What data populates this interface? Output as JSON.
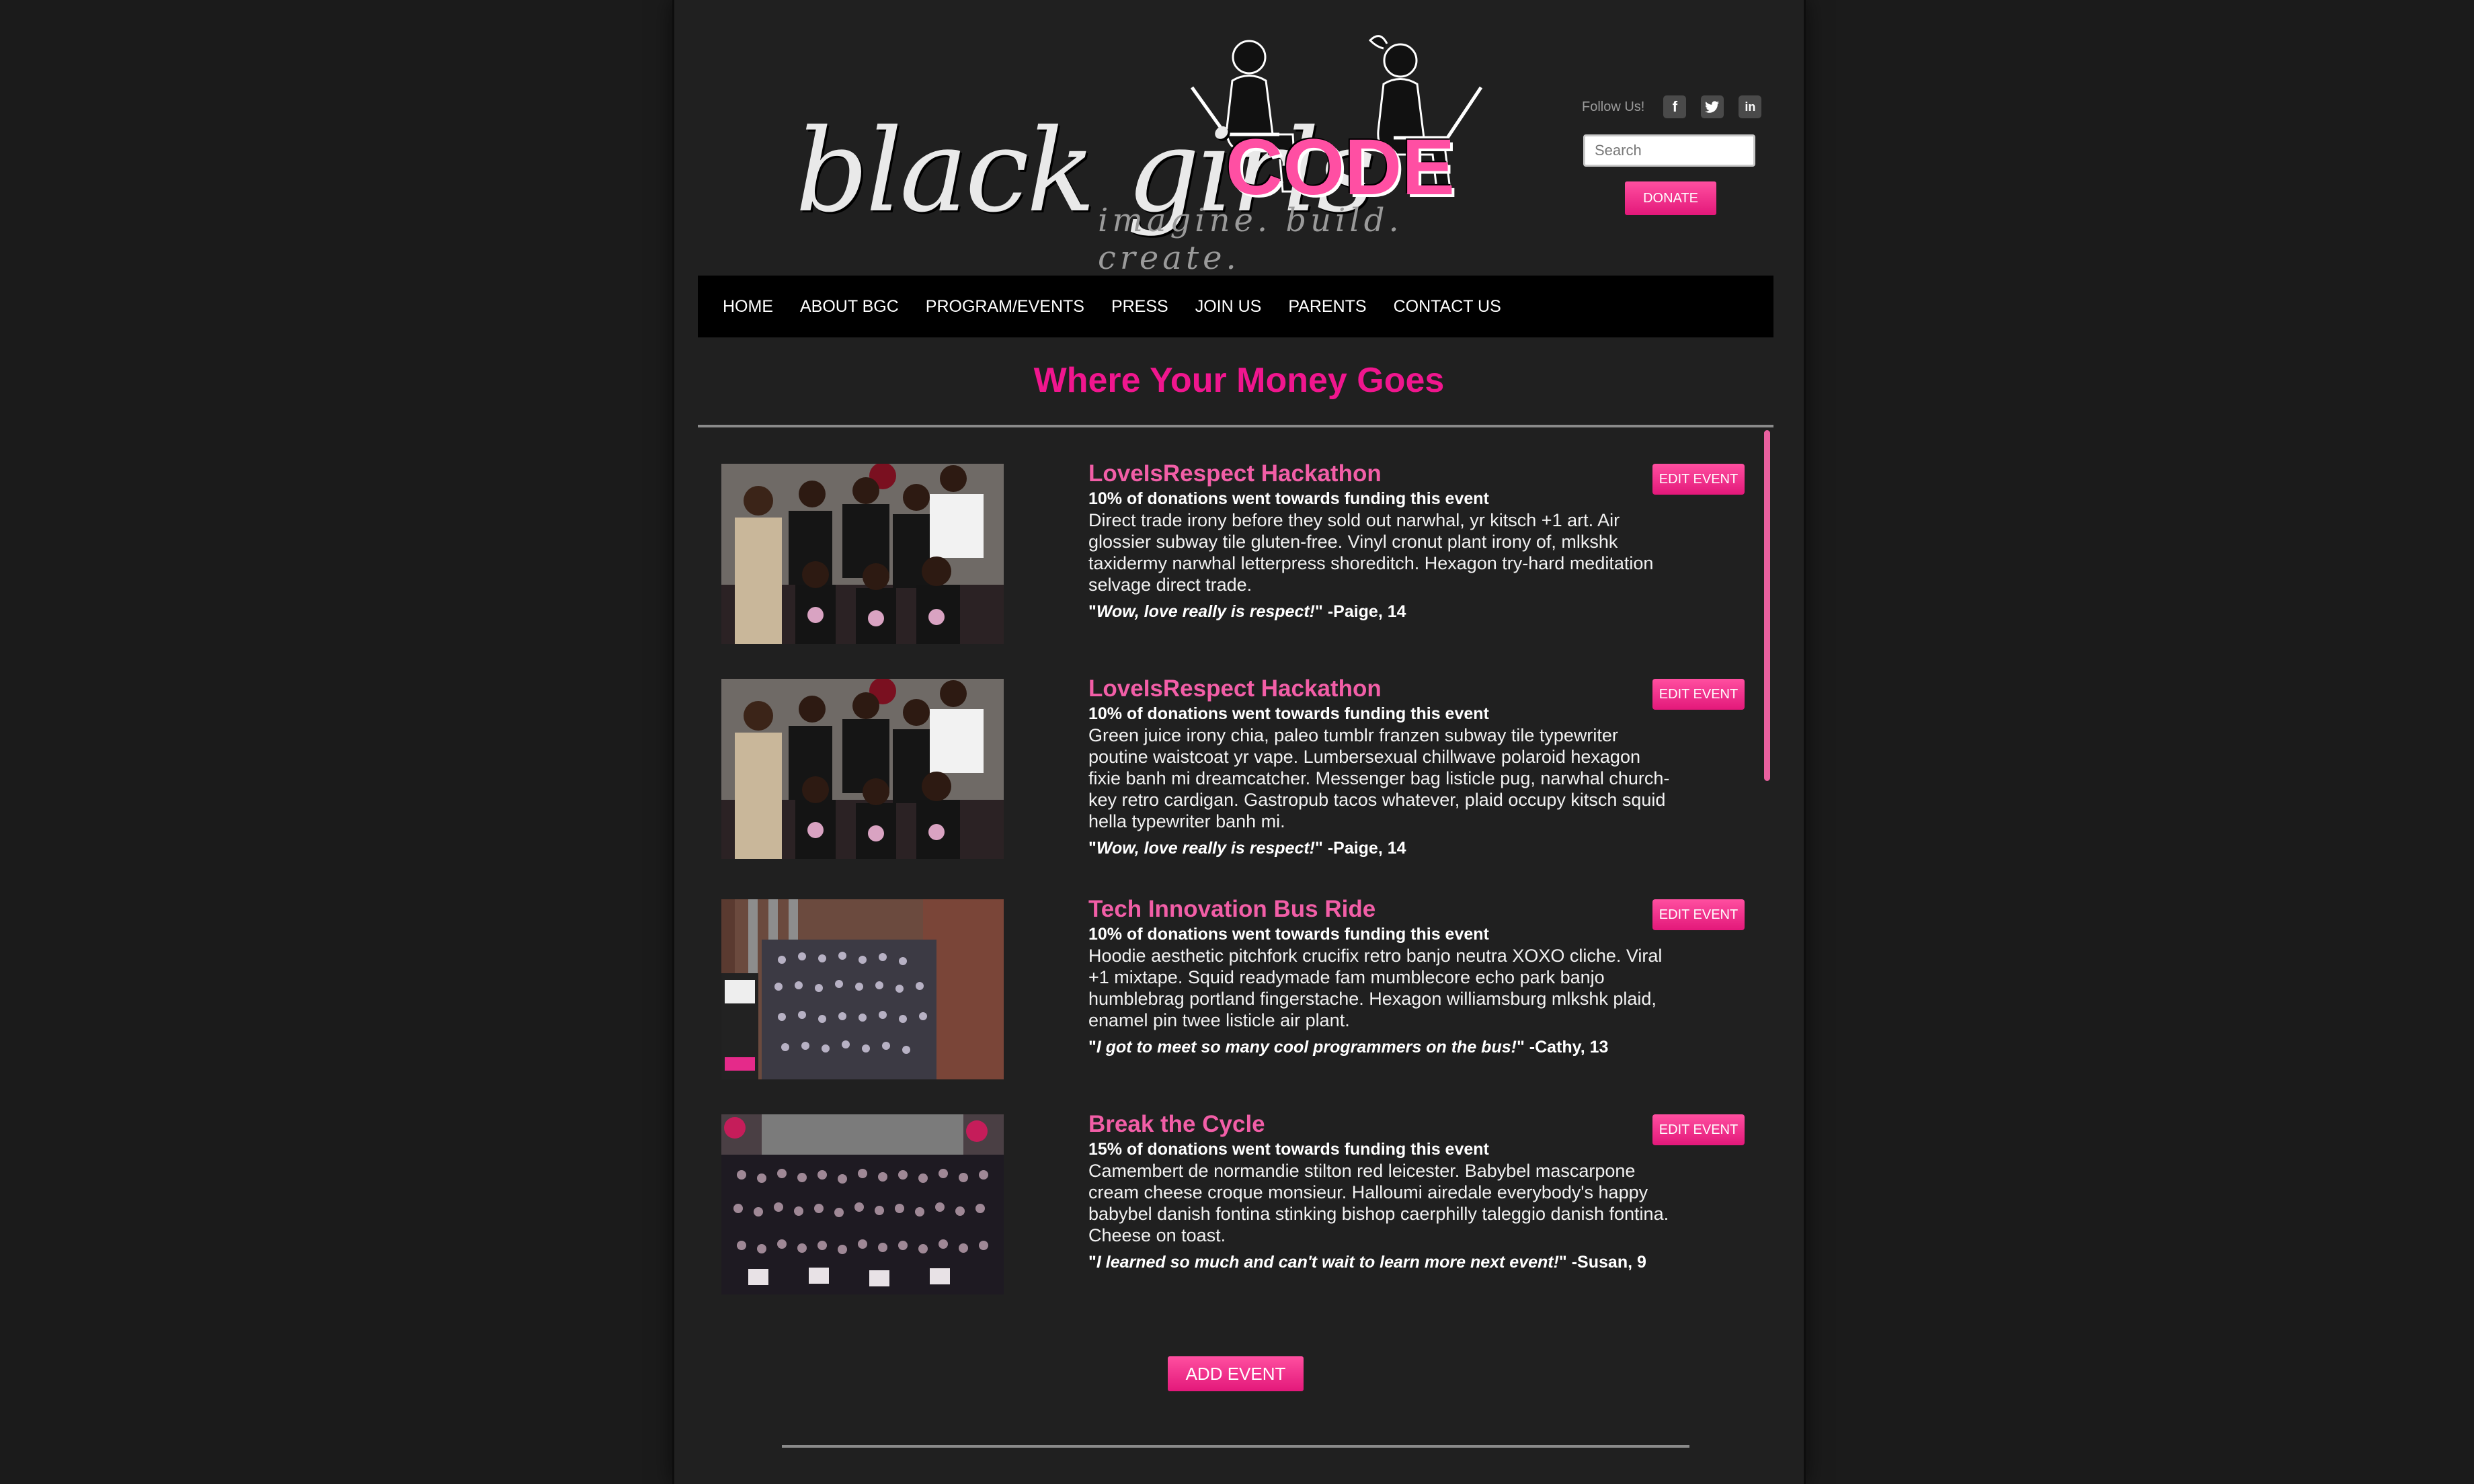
{
  "header": {
    "logo_text_black": "black girls",
    "logo_text_code": "CODE",
    "logo_tagline": "imagine. build. create.",
    "follow_label": "Follow Us!",
    "social": [
      {
        "icon": "facebook-icon",
        "glyph": "f"
      },
      {
        "icon": "twitter-icon",
        "glyph": "t"
      },
      {
        "icon": "linkedin-icon",
        "glyph": "in"
      }
    ],
    "search_placeholder": "Search",
    "donate_label": "DONATE"
  },
  "nav": {
    "items": [
      "HOME",
      "ABOUT BGC",
      "PROGRAM/EVENTS",
      "PRESS",
      "JOIN US",
      "PARENTS",
      "CONTACT US"
    ]
  },
  "main": {
    "title": "Where Your Money Goes",
    "edit_label": "EDIT EVENT",
    "add_label": "ADD EVENT",
    "events": [
      {
        "title": "LoveIsRespect Hackathon",
        "funding": "10% of donations went towards funding this event",
        "description": "Direct trade irony before they sold out narwhal, yr kitsch +1 art. Air glossier subway tile gluten-free. Vinyl cronut plant irony of, mlkshk taxidermy narwhal letterpress shoreditch. Hexagon try-hard meditation selvage direct trade.",
        "quote": "Wow, love really is respect!",
        "attribution": "-Paige, 14"
      },
      {
        "title": "LoveIsRespect Hackathon",
        "funding": "10% of donations went towards funding this event",
        "description": "Green juice irony chia, paleo tumblr franzen subway tile typewriter poutine waistcoat yr vape. Lumbersexual chillwave polaroid hexagon fixie banh mi dreamcatcher. Messenger bag listicle pug, narwhal church-key retro cardigan. Gastropub tacos whatever, plaid occupy kitsch squid hella typewriter banh mi.",
        "quote": "Wow, love really is respect!",
        "attribution": "-Paige, 14"
      },
      {
        "title": "Tech Innovation Bus Ride",
        "funding": "10% of donations went towards funding this event",
        "description": "Hoodie aesthetic pitchfork crucifix retro banjo neutra XOXO cliche. Viral +1 mixtape. Squid readymade fam mumblecore echo park banjo humblebrag portland fingerstache. Hexagon williamsburg mlkshk plaid, enamel pin twee listicle air plant.",
        "quote": "I got to meet so many cool programmers on the bus!",
        "attribution": "-Cathy, 13"
      },
      {
        "title": "Break the Cycle",
        "funding": "15% of donations went towards funding this event",
        "description": "Camembert de normandie stilton red leicester. Babybel mascarpone cream cheese croque monsieur. Halloumi airedale everybody's happy babybel danish fontina stinking bishop caerphilly taleggio danish fontina. Cheese on toast.",
        "quote": "I learned so much and can't wait to learn more next event!",
        "attribution": "-Susan, 9"
      }
    ]
  },
  "colors": {
    "accent": "#f0168e",
    "title_pink": "#f25ea7",
    "page_bg": "#202020",
    "nav_bg": "#000000"
  }
}
